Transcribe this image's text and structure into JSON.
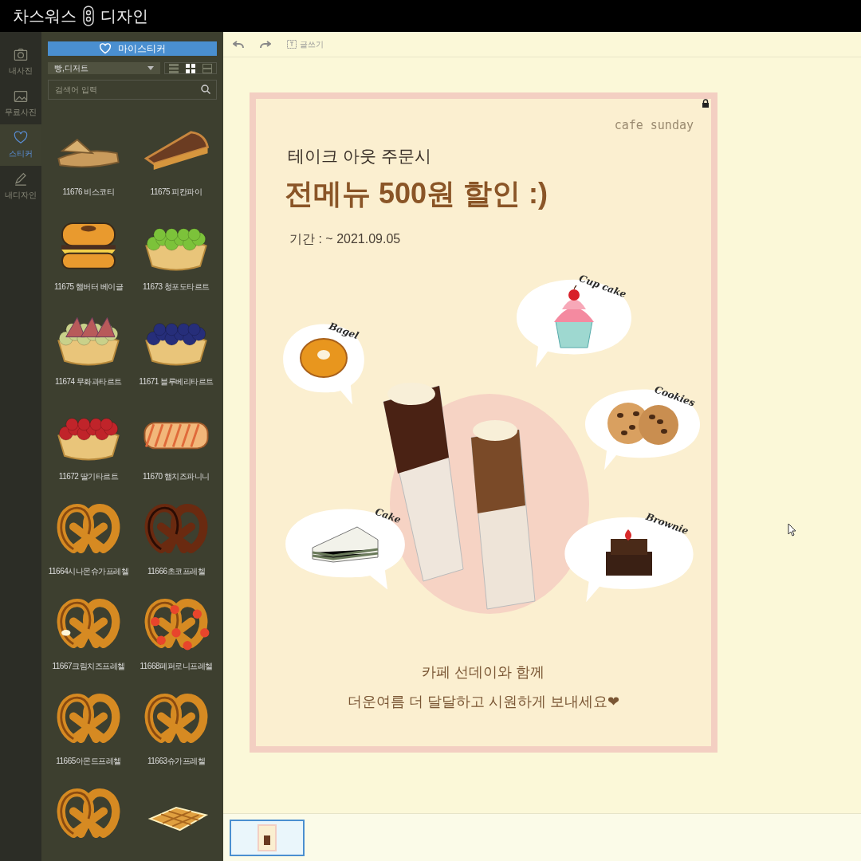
{
  "app_title": {
    "left": "차스워스",
    "right": "디자인"
  },
  "rail": [
    {
      "label": "내사진",
      "kind": "camera",
      "selected": false
    },
    {
      "label": "무료사진",
      "kind": "free-photo",
      "selected": false
    },
    {
      "label": "스티커",
      "kind": "heart",
      "selected": true
    },
    {
      "label": "내디자인",
      "kind": "pencil",
      "selected": false
    }
  ],
  "my_sticker_button": "마이스티커",
  "category_select": "빵,디저트",
  "view_modes": [
    {
      "kind": "list",
      "selected": false
    },
    {
      "kind": "grid",
      "selected": true
    },
    {
      "kind": "detail",
      "selected": false
    }
  ],
  "search": {
    "placeholder": "검색어 입력"
  },
  "stickers": [
    {
      "kind": "biscotti",
      "label": "11676 비스코티"
    },
    {
      "kind": "pie",
      "label": "11675 피칸파이"
    },
    {
      "kind": "bagel",
      "label": "11675 햄버터 베이글"
    },
    {
      "kind": "grape-tart",
      "label": "11673 청포도타르트"
    },
    {
      "kind": "fig-tart",
      "label": "11674 무화과타르트"
    },
    {
      "kind": "blueberry-tart",
      "label": "11671 블루베리타르트"
    },
    {
      "kind": "strawberry-tart",
      "label": "11672 딸기타르트"
    },
    {
      "kind": "panini",
      "label": "11670 햄치즈파니니"
    },
    {
      "kind": "pretzel",
      "label": "11664시나몬슈가프레첼"
    },
    {
      "kind": "choco-pretzel",
      "label": "11666초코프레첼"
    },
    {
      "kind": "cheese-pretzel",
      "label": "11667크림치즈프레첼"
    },
    {
      "kind": "pepperoni-pretzel",
      "label": "11668페퍼로니프레첼"
    },
    {
      "kind": "pretzel",
      "label": "11665아몬드프레첼"
    },
    {
      "kind": "pretzel",
      "label": "11663슈가프레첼"
    },
    {
      "kind": "pretzel"
    },
    {
      "kind": "waffle"
    }
  ],
  "toolbar": {
    "text_tool": "글쓰기"
  },
  "poster": {
    "brand": "cafe sunday",
    "subtitle": "테이크 아웃 주문시",
    "headline": "전메뉴 500원 할인 :)",
    "period": "기간 : ~ 2021.09.05",
    "bubbles": [
      {
        "kind": "cupcake",
        "label": "Cup cake"
      },
      {
        "kind": "bagel",
        "label": "Bagel"
      },
      {
        "kind": "cookies",
        "label": "Cookies"
      },
      {
        "kind": "cake",
        "label": "Cake"
      },
      {
        "kind": "brownie",
        "label": "Brownie"
      }
    ],
    "footer": [
      "카페 선데이와 함께",
      "더운여름 더 달달하고 시원하게 보내세요❤"
    ]
  },
  "pages": [
    {
      "selected": true
    }
  ]
}
